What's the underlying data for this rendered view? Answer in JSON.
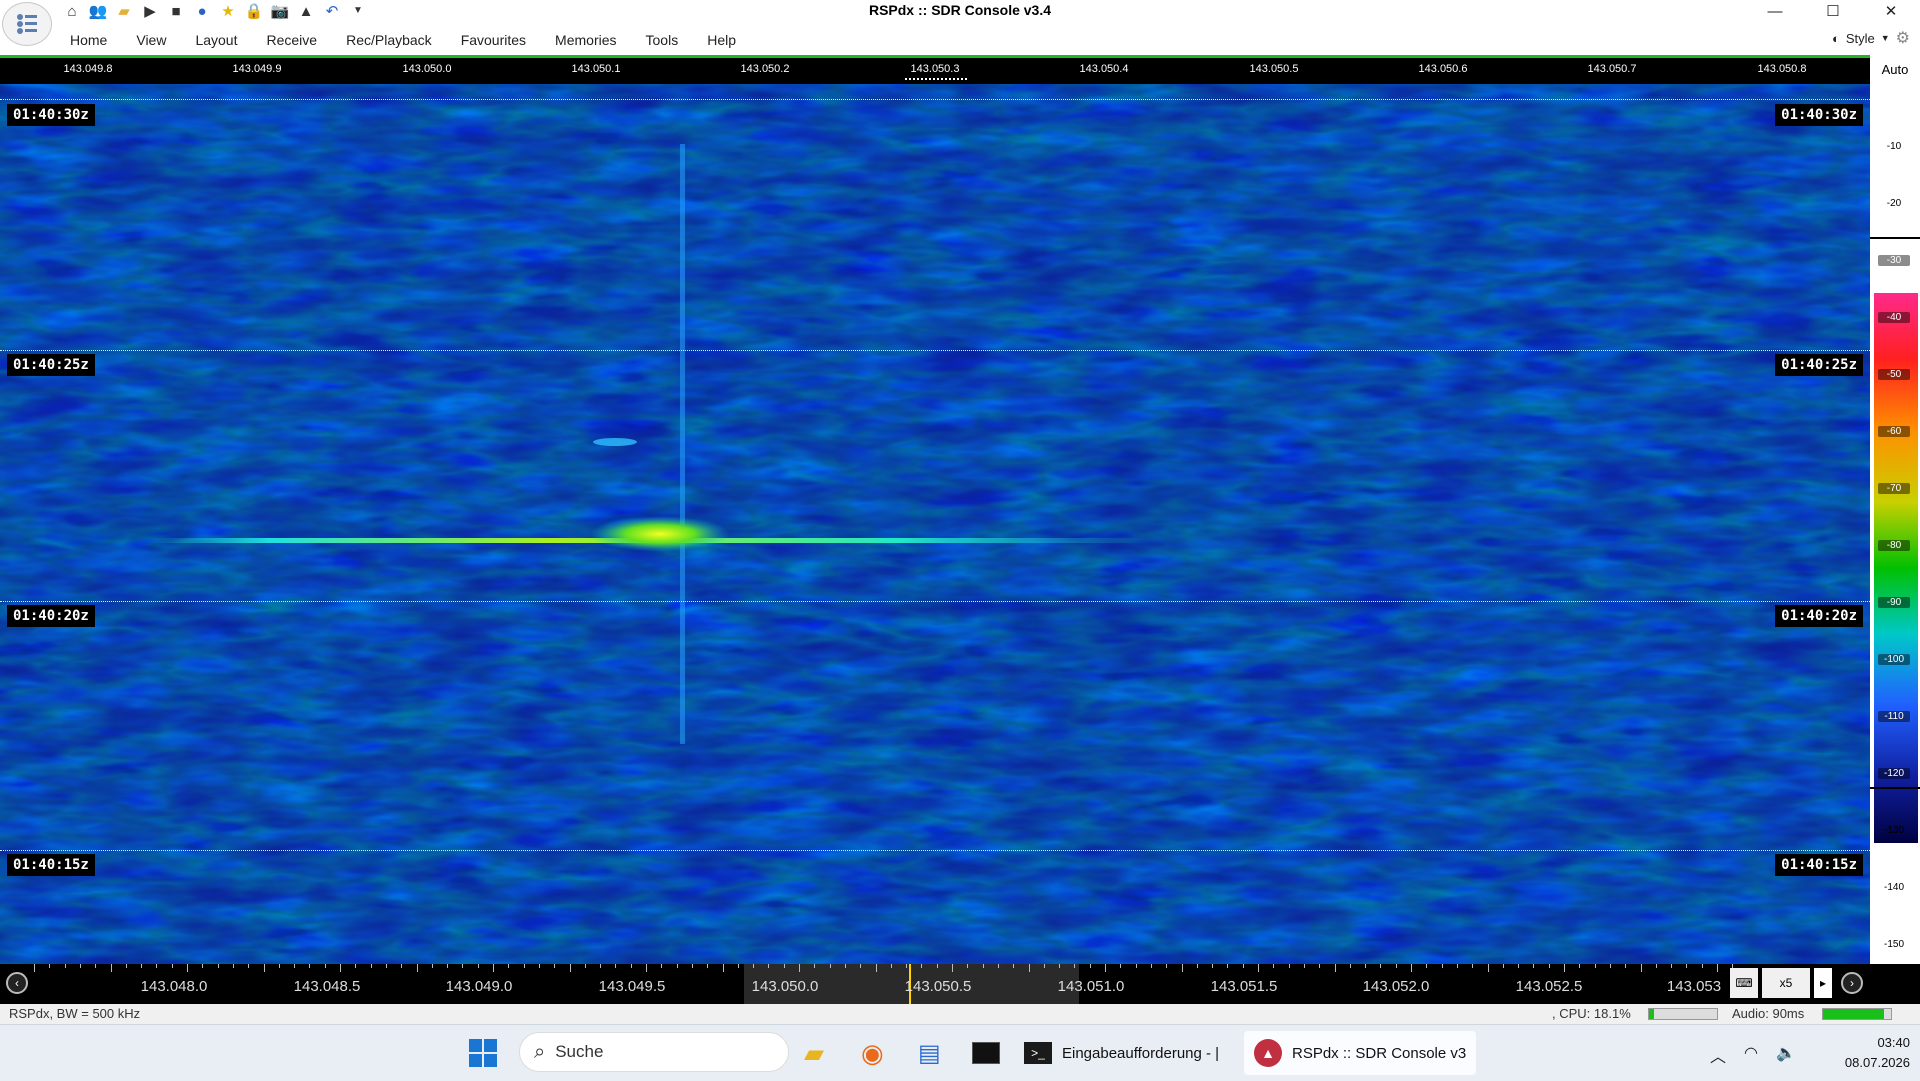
{
  "window": {
    "title": "RSPdx :: SDR Console v3.4"
  },
  "quick_access": [
    "home-icon",
    "users-icon",
    "folder-icon",
    "play-icon",
    "stop-icon",
    "record-icon",
    "star-icon",
    "lock-icon",
    "camera-icon",
    "antenna-icon",
    "undo-icon",
    "dropdown-icon"
  ],
  "menu": [
    "Home",
    "View",
    "Layout",
    "Receive",
    "Rec/Playback",
    "Favourites",
    "Memories",
    "Tools",
    "Help"
  ],
  "style_label": "Style",
  "top_freq_ticks": [
    "143.049.8",
    "143.049.9",
    "143.050.0",
    "143.050.1",
    "143.050.2",
    "143.050.3",
    "143.050.4",
    "143.050.5",
    "143.050.6",
    "143.050.7",
    "143.050.8"
  ],
  "timestamps": [
    "01:40:30z",
    "01:40:25z",
    "01:40:20z",
    "01:40:15z"
  ],
  "right_panel": {
    "auto_label": "Auto",
    "db_labels": [
      "-10",
      "-20",
      "-30",
      "-40",
      "-50",
      "-60",
      "-70",
      "-80",
      "-90",
      "-100",
      "-110",
      "-120",
      "-130",
      "-140",
      "-150"
    ]
  },
  "bottom_axis": {
    "labels": [
      "143.048.0",
      "143.048.5",
      "143.049.0",
      "143.049.5",
      "143.050.0",
      "143.050.5",
      "143.051.0",
      "143.051.5",
      "143.052.0",
      "143.052.5",
      "143.053"
    ],
    "zoom": "x5"
  },
  "status": {
    "left": "RSPdx, BW = 500 kHz",
    "cpu": ", CPU: 18.1%",
    "cpu_fraction": 0.08,
    "audio": "Audio: 90ms",
    "audio_fraction": 0.9
  },
  "taskbar": {
    "search_placeholder": "Suche",
    "apps": [
      "Eingabeaufforderung - |",
      "RSPdx :: SDR Console v3"
    ],
    "time": "03:40",
    "date": "08.07.2026"
  },
  "colors": {
    "waterfall_bg": "#0c1f9a",
    "signal": "#00d8d0",
    "accent_green": "#1fb81f"
  }
}
